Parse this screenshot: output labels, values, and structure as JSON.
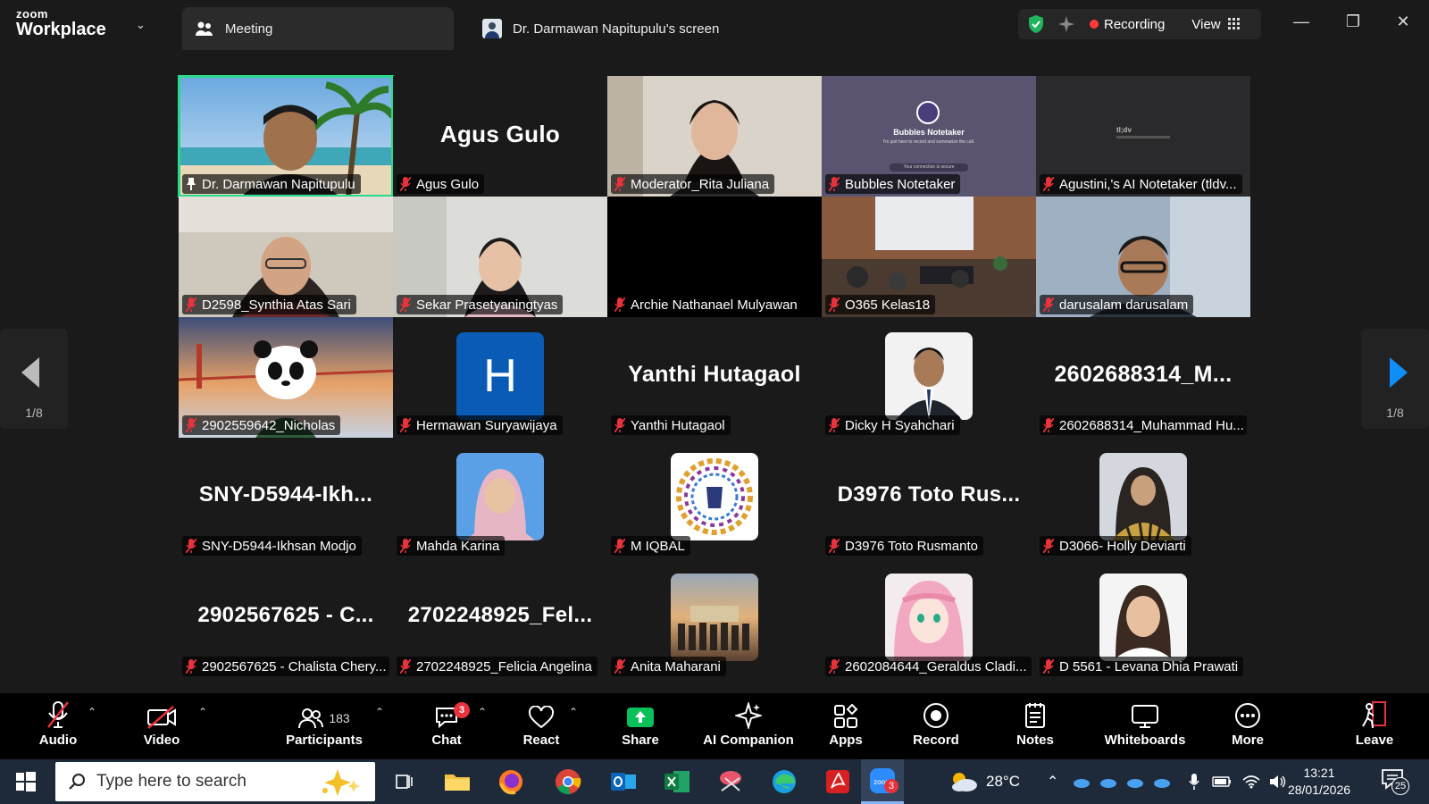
{
  "app": {
    "brand_top": "zoom",
    "brand_bottom": "Workplace"
  },
  "tabs": {
    "meeting": "Meeting",
    "screen": "Dr. Darmawan Napitupulu's screen"
  },
  "status": {
    "recording": "Recording",
    "view": "View"
  },
  "gallery": {
    "page_left": "1/8",
    "page_right": "1/8",
    "tiles": [
      {
        "name": "Dr. Darmawan Napitupulu",
        "big": ""
      },
      {
        "name": "Agus Gulo",
        "big": "Agus Gulo"
      },
      {
        "name": "Moderator_Rita Juliana",
        "big": ""
      },
      {
        "name": "Bubbles Notetaker",
        "big": ""
      },
      {
        "name": "Agustini,'s AI Notetaker (tldv...",
        "big": ""
      },
      {
        "name": "D2598_Synthia Atas Sari",
        "big": ""
      },
      {
        "name": "Sekar Prasetyaningtyas",
        "big": ""
      },
      {
        "name": "Archie Nathanael Mulyawan",
        "big": ""
      },
      {
        "name": "O365 Kelas18",
        "big": ""
      },
      {
        "name": "darusalam darusalam",
        "big": ""
      },
      {
        "name": "2902559642_Nicholas",
        "big": ""
      },
      {
        "name": "Hermawan Suryawijaya",
        "big": "H"
      },
      {
        "name": "Yanthi Hutagaol",
        "big": "Yanthi Hutagaol"
      },
      {
        "name": "Dicky H Syahchari",
        "big": ""
      },
      {
        "name": "2602688314_Muhammad Hu...",
        "big": "2602688314_M..."
      },
      {
        "name": "SNY-D5944-Ikhsan Modjo",
        "big": "SNY-D5944-Ikh..."
      },
      {
        "name": "Mahda Karina",
        "big": ""
      },
      {
        "name": "M IQBAL",
        "big": ""
      },
      {
        "name": "D3976 Toto Rusmanto",
        "big": "D3976 Toto Rus..."
      },
      {
        "name": "D3066- Holly Deviarti",
        "big": ""
      },
      {
        "name": "2902567625 - Chalista Chery...",
        "big": "2902567625 - C..."
      },
      {
        "name": "2702248925_Felicia Angelina",
        "big": "2702248925_Fel..."
      },
      {
        "name": "Anita Maharani",
        "big": ""
      },
      {
        "name": "2602084644_Geraldus Cladi...",
        "big": ""
      },
      {
        "name": "D 5561 - Levana Dhia Prawati",
        "big": ""
      }
    ],
    "bubbles_title": "Bubbles Notetaker",
    "bubbles_sub": "I'm just here to record and summarize the call.",
    "bubbles_footer": "Your connection is secure",
    "tldv_label": "tl;dv"
  },
  "controls": {
    "audio": "Audio",
    "video": "Video",
    "participants": "Participants",
    "participants_count": "183",
    "chat": "Chat",
    "chat_badge": "3",
    "react": "React",
    "share": "Share",
    "ai": "AI Companion",
    "apps": "Apps",
    "record": "Record",
    "notes": "Notes",
    "whiteboards": "Whiteboards",
    "more": "More",
    "leave": "Leave"
  },
  "taskbar": {
    "search_placeholder": "Type here to search",
    "temperature": "28°C",
    "time": "13:21",
    "date": "28/01/2026",
    "notif_count": "25",
    "zoom_badge": "3"
  },
  "colors": {
    "active_speaker": "#2bd98a",
    "recording_dot": "#ff3b3b",
    "share_green": "#0ac05a",
    "taskbar": "#1e2a3a"
  }
}
